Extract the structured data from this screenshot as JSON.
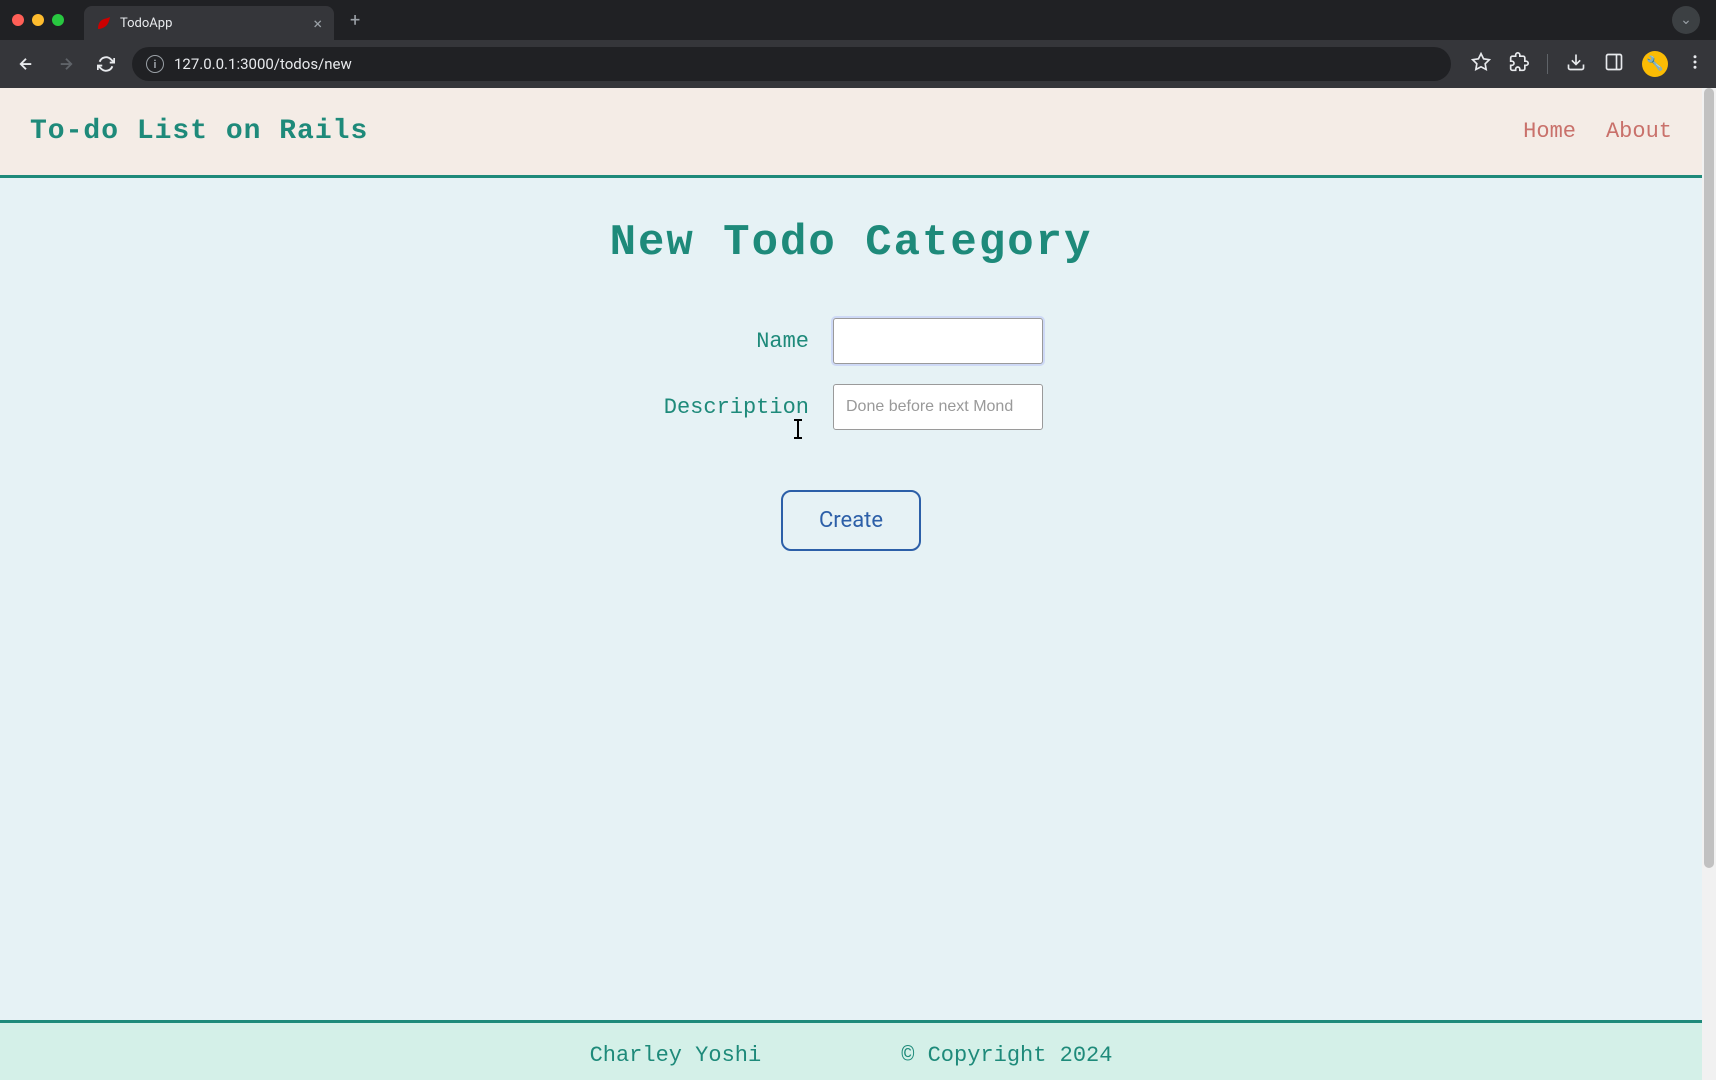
{
  "browser": {
    "tab_title": "TodoApp",
    "url": "127.0.0.1:3000/todos/new"
  },
  "header": {
    "brand": "To-do List on Rails",
    "nav": {
      "home": "Home",
      "about": "About"
    }
  },
  "main": {
    "title": "New Todo Category",
    "form": {
      "name_label": "Name",
      "name_value": "",
      "name_placeholder": "",
      "description_label": "Description",
      "description_value": "",
      "description_placeholder": "Done before next Mond",
      "submit_label": "Create"
    }
  },
  "footer": {
    "author": "Charley Yoshi",
    "copyright": "© Copyright 2024"
  }
}
